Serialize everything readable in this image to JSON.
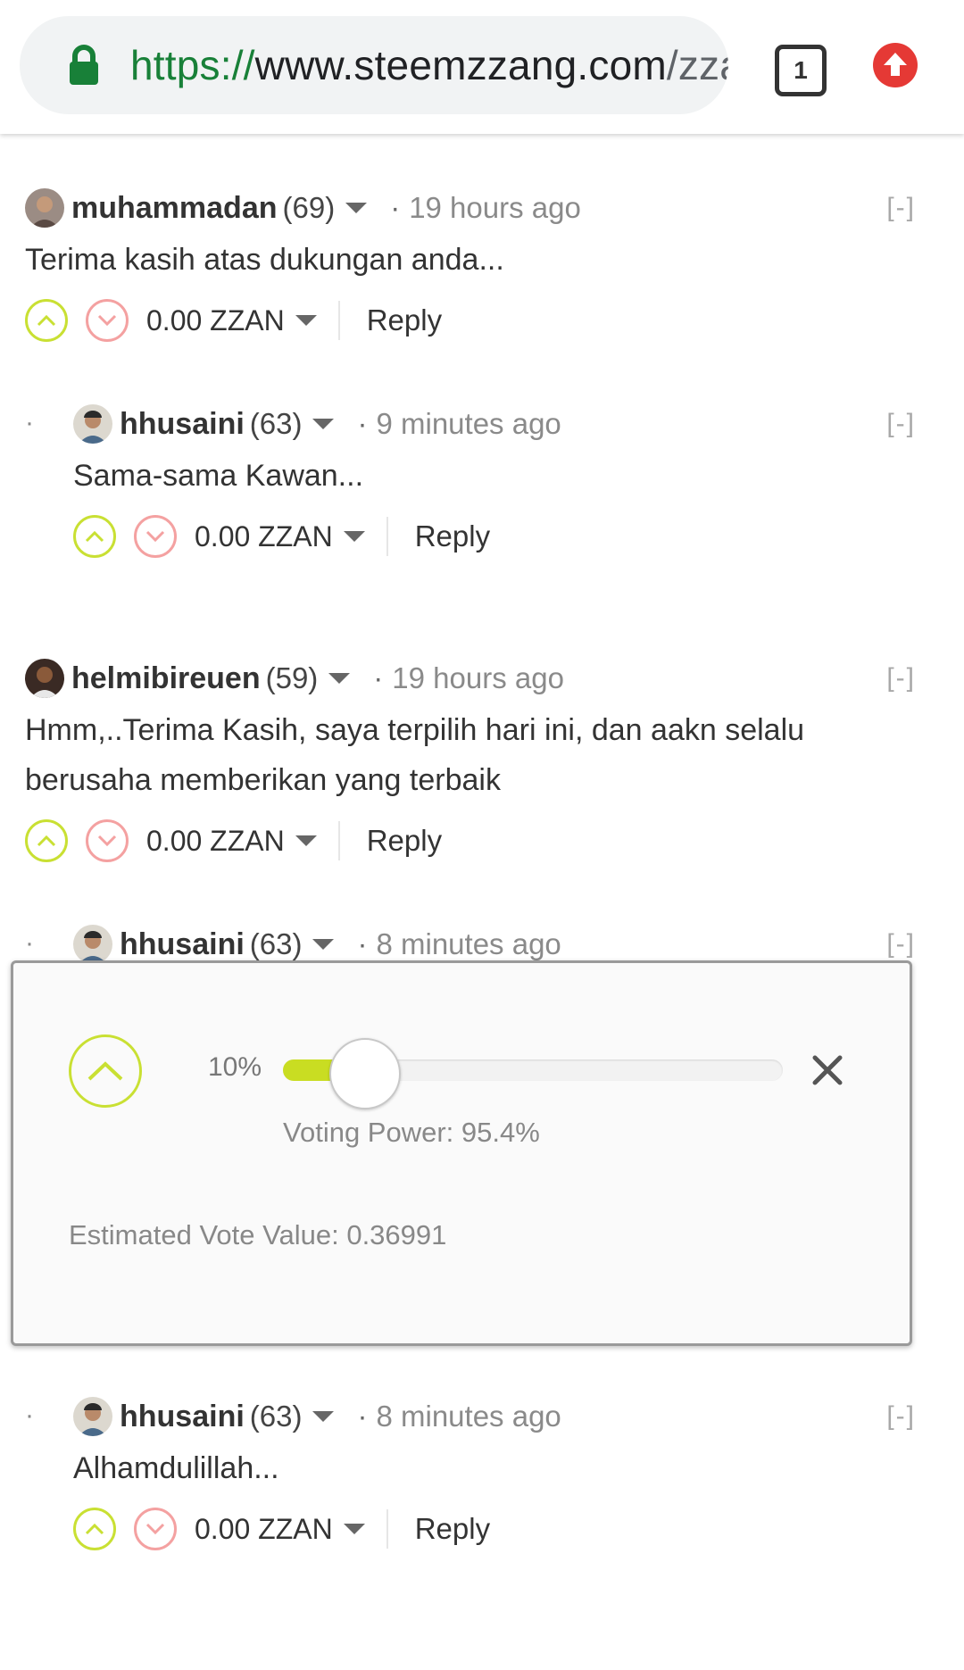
{
  "browser": {
    "url_scheme": "https://",
    "url_host": "www.steemzzang.com",
    "url_path": "/zza",
    "tab_count": "1"
  },
  "comments": [
    {
      "author": "muhammadan",
      "rep": "(69)",
      "time": "19 hours ago",
      "collapse": "[-]",
      "text": "Terima kasih atas dukungan anda...",
      "payout": "0.00 ZZAN",
      "reply": "Reply"
    },
    {
      "author": "hhusaini",
      "rep": "(63)",
      "time": "9 minutes ago",
      "collapse": "[-]",
      "text": "Sama-sama Kawan...",
      "payout": "0.00 ZZAN",
      "reply": "Reply"
    },
    {
      "author": "helmibireuen",
      "rep": "(59)",
      "time": "19 hours ago",
      "collapse": "[-]",
      "text_line1": "Hmm,..Terima Kasih, saya terpilih hari ini, dan aakn selalu",
      "text_line2": "berusaha memberikan yang terbaik",
      "payout": "0.00 ZZAN",
      "reply": "Reply"
    },
    {
      "author": "hhusaini",
      "rep": "(63)",
      "time": "8 minutes ago",
      "collapse": "[-]"
    },
    {
      "author": "hhusaini",
      "rep": "(63)",
      "time": "8 minutes ago",
      "collapse": "[-]",
      "text": "Alhamdulillah...",
      "payout": "0.00 ZZAN",
      "reply": "Reply"
    }
  ],
  "vote_popup": {
    "weight_label": "10%",
    "weight_fraction": 0.1,
    "voting_power": "Voting Power: 95.4%",
    "estimated_value": "Estimated Vote Value: 0.36991"
  },
  "colors": {
    "upvote": "#c9e033",
    "downvote": "#f4a1a1",
    "slider_fill": "#c9dd22",
    "secure_green": "#188038",
    "update_red": "#e53935"
  }
}
